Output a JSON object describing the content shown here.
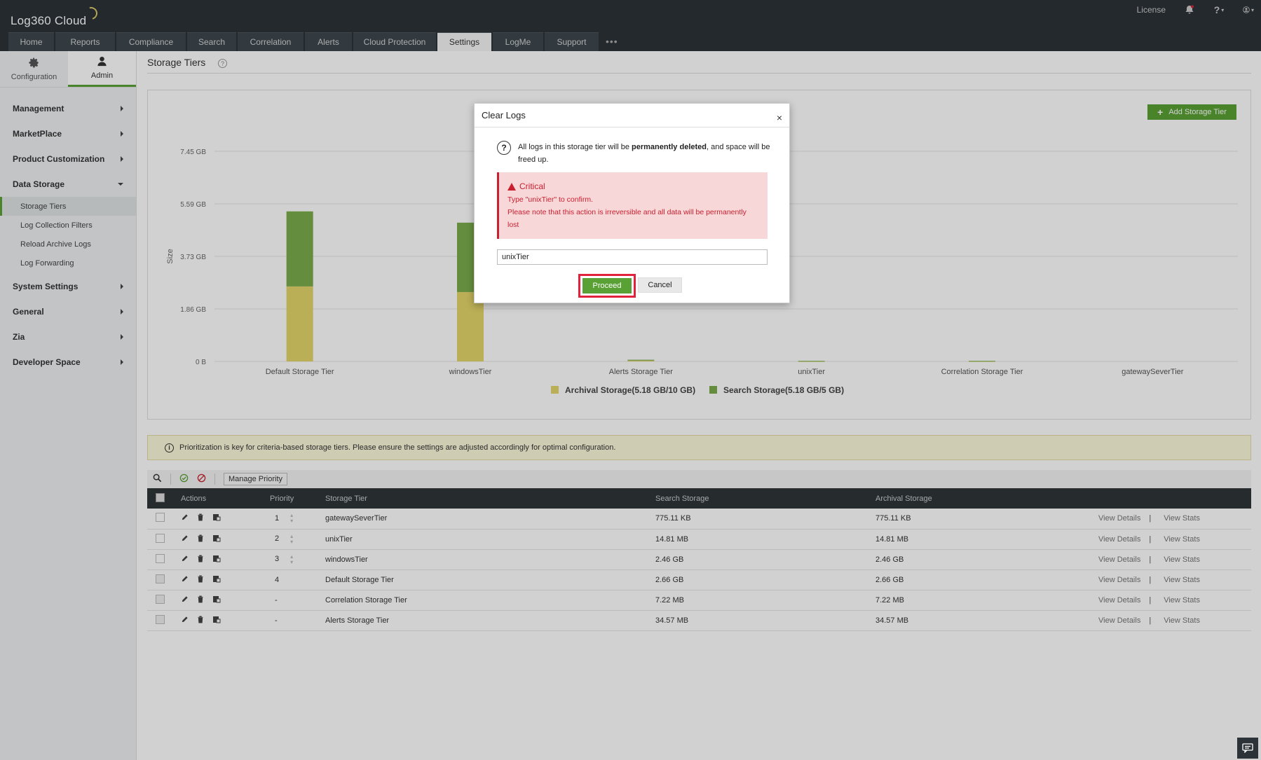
{
  "app": {
    "title": "Log360 Cloud"
  },
  "topright": {
    "license": "License",
    "bell_icon": "bell-icon",
    "help_icon": "help-icon",
    "user_icon": "user-icon"
  },
  "tabs": [
    {
      "label": "Home"
    },
    {
      "label": "Reports"
    },
    {
      "label": "Compliance"
    },
    {
      "label": "Search"
    },
    {
      "label": "Correlation"
    },
    {
      "label": "Alerts"
    },
    {
      "label": "Cloud Protection"
    },
    {
      "label": "Settings"
    },
    {
      "label": "LogMe"
    },
    {
      "label": "Support"
    }
  ],
  "tabs_more": "•••",
  "sidebar": {
    "config_label": "Configuration",
    "admin_label": "Admin",
    "menu": [
      {
        "label": "Management"
      },
      {
        "label": "MarketPlace"
      },
      {
        "label": "Product Customization"
      },
      {
        "label": "Data Storage"
      },
      {
        "label": "System Settings"
      },
      {
        "label": "General"
      },
      {
        "label": "Zia"
      },
      {
        "label": "Developer Space"
      }
    ],
    "data_storage_items": [
      {
        "label": "Storage Tiers"
      },
      {
        "label": "Log Collection Filters"
      },
      {
        "label": "Reload Archive Logs"
      },
      {
        "label": "Log Forwarding"
      }
    ]
  },
  "page": {
    "title": "Storage Tiers",
    "help": "?",
    "add_button": "Add Storage Tier",
    "info_text": "Prioritization is key for criteria-based storage tiers. Please ensure the settings are adjusted accordingly for optimal configuration.",
    "manage_priority": "Manage Priority"
  },
  "chart_data": {
    "type": "bar",
    "stacked": true,
    "categories": [
      "Default Storage Tier",
      "windowsTier",
      "Alerts Storage Tier",
      "unixTier",
      "Correlation Storage Tier",
      "gatewaySeverTier"
    ],
    "series": [
      {
        "name": "Archival Storage(5.18 GB/10 GB)",
        "color": "#e3d56a",
        "values": [
          2.66,
          2.46,
          0.03,
          0.01,
          0.01,
          0.0
        ]
      },
      {
        "name": "Search Storage(5.18 GB/5 GB)",
        "color": "#7cad4c",
        "values": [
          2.66,
          2.46,
          0.03,
          0.01,
          0.01,
          0.0
        ]
      }
    ],
    "ylabel": "Size",
    "yticks": [
      "0 B",
      "1.86 GB",
      "3.73 GB",
      "5.59 GB",
      "7.45 GB"
    ],
    "ylim": [
      0,
      7.45
    ],
    "grid": true,
    "legend": "bottom-center"
  },
  "table": {
    "headers": {
      "actions": "Actions",
      "priority": "Priority",
      "tier": "Storage Tier",
      "search": "Search Storage",
      "archival": "Archival Storage"
    },
    "view_details": "View Details",
    "view_stats": "View Stats",
    "separator": "|",
    "rows": [
      {
        "priority": "1",
        "tier": "gatewaySeverTier",
        "search": "775.11 KB",
        "archival": "775.11 KB"
      },
      {
        "priority": "2",
        "tier": "unixTier",
        "search": "14.81 MB",
        "archival": "14.81 MB"
      },
      {
        "priority": "3",
        "tier": "windowsTier",
        "search": "2.46 GB",
        "archival": "2.46 GB"
      },
      {
        "priority": "4",
        "tier": "Default Storage Tier",
        "search": "2.66 GB",
        "archival": "2.66 GB"
      },
      {
        "priority": "-",
        "tier": "Correlation Storage Tier",
        "search": "7.22 MB",
        "archival": "7.22 MB"
      },
      {
        "priority": "-",
        "tier": "Alerts Storage Tier",
        "search": "34.57 MB",
        "archival": "34.57 MB"
      }
    ]
  },
  "modal": {
    "title": "Clear Logs",
    "close": "×",
    "msg_pre": "All logs in this storage tier will be ",
    "msg_bold": "permanently deleted",
    "msg_post": ", and space will be freed up.",
    "critical_title": "Critical",
    "critical_line1": "Type \"unixTier\" to confirm.",
    "critical_line2": "Please note that this action is irreversible and all data will be permanently lost",
    "input_value": "unixTier",
    "proceed": "Proceed",
    "cancel": "Cancel"
  }
}
